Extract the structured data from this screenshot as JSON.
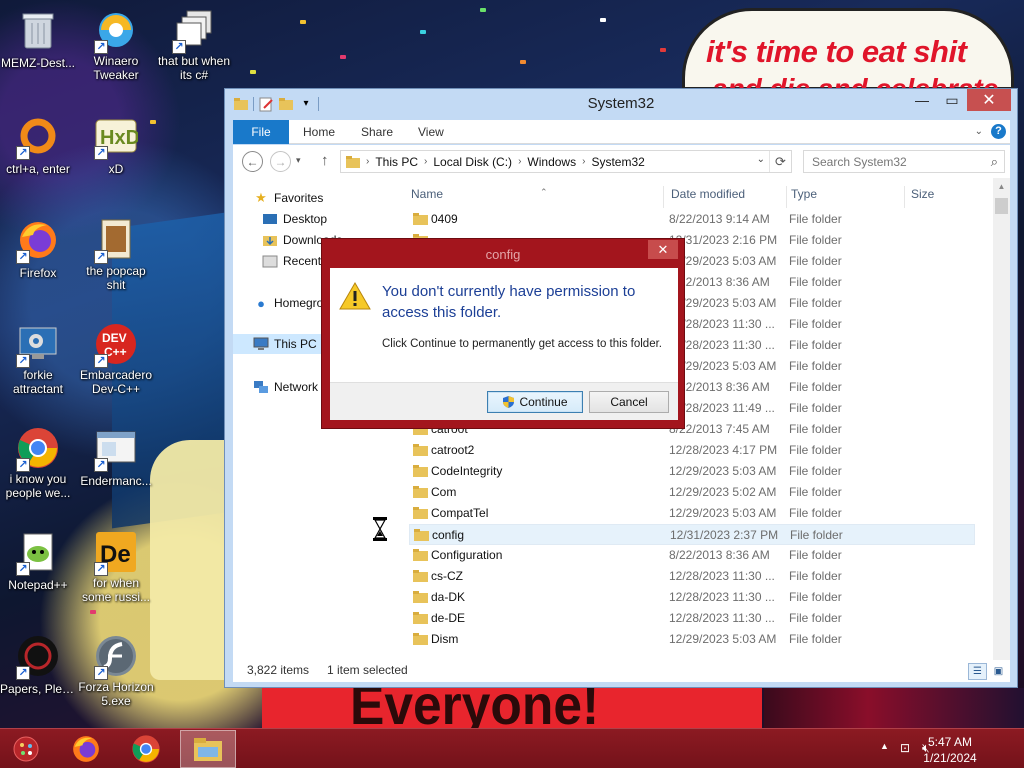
{
  "wallpaper": {
    "meme_text_line1": "it's time to eat shit",
    "meme_text_line2": "and die and celebrate",
    "banner_text": "Everyone!"
  },
  "desktop_icons": [
    {
      "label": "MEMZ-Dest...",
      "icon": "recycle-bin-icon"
    },
    {
      "label": "Winaero Tweaker",
      "line1": "Winaero",
      "line2": "Tweaker",
      "icon": "winaero-icon"
    },
    {
      "label": "that but when its c#",
      "line1": "that but when",
      "line2": "its c#",
      "icon": "stacked-windows-icon"
    },
    {
      "label": "ctrl+a, enter",
      "icon": "orange-ring-icon"
    },
    {
      "label": "xD",
      "icon": "hxd-icon"
    },
    {
      "label": "Firefox",
      "icon": "firefox-icon"
    },
    {
      "label": "the popcap shit",
      "line1": "the popcap",
      "line2": "shit",
      "icon": "popcap-icon"
    },
    {
      "label": "forkie attractant",
      "line1": "forkie",
      "line2": "attractant",
      "icon": "settings-monitor-icon"
    },
    {
      "label": "Embarcadero Dev-C++",
      "line1": "Embarcadero",
      "line2": "Dev-C++",
      "icon": "devcpp-icon"
    },
    {
      "label": "i know you people we...",
      "line1": "i know you",
      "line2": "people we...",
      "icon": "chrome-icon"
    },
    {
      "label": "Endermanc...",
      "icon": "window-app-icon"
    },
    {
      "label": "Notepad++",
      "icon": "notepadpp-icon"
    },
    {
      "label": "for when some russi...",
      "line1": "for when",
      "line2": "some russi...",
      "icon": "de-app-icon"
    },
    {
      "label": "Papers, Please",
      "icon": "papers-please-icon"
    },
    {
      "label": "Forza Horizon 5.exe",
      "line1": "Forza Horizon",
      "line2": "5.exe",
      "icon": "flash-icon"
    }
  ],
  "explorer": {
    "title": "System32",
    "tabs": {
      "file": "File",
      "home": "Home",
      "share": "Share",
      "view": "View"
    },
    "breadcrumb": [
      "This PC",
      "Local Disk (C:)",
      "Windows",
      "System32"
    ],
    "search_placeholder": "Search System32",
    "nav": {
      "favorites": "Favorites",
      "desktop": "Desktop",
      "downloads": "Downloads",
      "recent": "Recent places",
      "homegroup": "Homegroup",
      "this_pc": "This PC",
      "network": "Network"
    },
    "columns": {
      "name": "Name",
      "date": "Date modified",
      "type": "Type",
      "size": "Size"
    },
    "files": [
      {
        "name": "0409",
        "date": "8/22/2013 9:14 AM",
        "type": "File folder"
      },
      {
        "name": "",
        "date": "12/31/2023 2:16 PM",
        "type": "File folder"
      },
      {
        "name": "",
        "date": "12/29/2023 5:03 AM",
        "type": "File folder"
      },
      {
        "name": "",
        "date": "8/22/2013 8:36 AM",
        "type": "File folder"
      },
      {
        "name": "",
        "date": "12/29/2023 5:03 AM",
        "type": "File folder"
      },
      {
        "name": "",
        "date": "12/28/2023 11:30 ...",
        "type": "File folder"
      },
      {
        "name": "",
        "date": "12/28/2023 11:30 ...",
        "type": "File folder"
      },
      {
        "name": "",
        "date": "12/29/2023 5:03 AM",
        "type": "File folder"
      },
      {
        "name": "",
        "date": "8/22/2013 8:36 AM",
        "type": "File folder"
      },
      {
        "name": "",
        "date": "12/28/2023 11:49 ...",
        "type": "File folder"
      },
      {
        "name": "catroot",
        "date": "8/22/2013 7:45 AM",
        "type": "File folder"
      },
      {
        "name": "catroot2",
        "date": "12/28/2023 4:17 PM",
        "type": "File folder"
      },
      {
        "name": "CodeIntegrity",
        "date": "12/29/2023 5:03 AM",
        "type": "File folder"
      },
      {
        "name": "Com",
        "date": "12/29/2023 5:02 AM",
        "type": "File folder"
      },
      {
        "name": "CompatTel",
        "date": "12/29/2023 5:03 AM",
        "type": "File folder"
      },
      {
        "name": "config",
        "date": "12/31/2023 2:37 PM",
        "type": "File folder",
        "selected": true
      },
      {
        "name": "Configuration",
        "date": "8/22/2013 8:36 AM",
        "type": "File folder"
      },
      {
        "name": "cs-CZ",
        "date": "12/28/2023 11:30 ...",
        "type": "File folder"
      },
      {
        "name": "da-DK",
        "date": "12/28/2023 11:30 ...",
        "type": "File folder"
      },
      {
        "name": "de-DE",
        "date": "12/28/2023 11:30 ...",
        "type": "File folder"
      },
      {
        "name": "Dism",
        "date": "12/29/2023 5:03 AM",
        "type": "File folder"
      }
    ],
    "status": {
      "count": "3,822 items",
      "selected": "1 item selected"
    }
  },
  "dialog": {
    "title": "config",
    "message": "You don't currently have permission to access this folder.",
    "detail": "Click Continue to permanently get access to this folder.",
    "continue_label": "Continue",
    "cancel_label": "Cancel"
  },
  "taskbar": {
    "apps": [
      "firefox-icon",
      "chrome-icon",
      "file-explorer-icon"
    ],
    "time": "5:47 AM",
    "date": "1/21/2024"
  },
  "colors": {
    "accent": "#1979ca",
    "taskbar": "#7e1820",
    "dialog_frame": "#a3151d",
    "dialog_message": "#1c3f96"
  }
}
